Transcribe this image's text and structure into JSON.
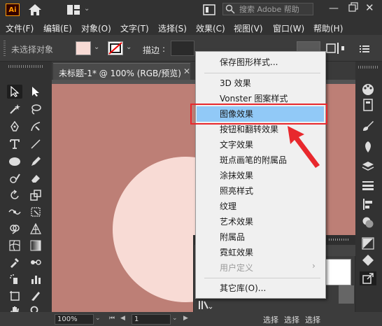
{
  "app": {
    "logo_text": "Ai",
    "search_placeholder": "搜索 Adobe 帮助",
    "accent_color": "#ff9a00"
  },
  "menubar": {
    "items": [
      "文件(F)",
      "编辑(E)",
      "对象(O)",
      "文字(T)",
      "选择(S)",
      "效果(C)",
      "视图(V)",
      "窗口(W)",
      "帮助(H)"
    ]
  },
  "controlbar": {
    "selection_status": "未选择对象",
    "fill_color": "#f8dbd5",
    "stroke_label": "描边",
    "stroke_colon": ":"
  },
  "document": {
    "tab_title": "未标题-1* @ 100% (RGB/预览)",
    "tab_close": "✕",
    "artboard_color": "#bd7f76",
    "circle_color": "#f8dbd5"
  },
  "dropdown": {
    "items": [
      {
        "label": "保存图形样式...",
        "enabled": true
      },
      {
        "label": "3D 效果",
        "enabled": true
      },
      {
        "label": "Vonster 图案样式",
        "enabled": true
      },
      {
        "label": "图像效果",
        "enabled": true,
        "highlighted": true
      },
      {
        "label": "按钮和翻转效果",
        "enabled": true
      },
      {
        "label": "文字效果",
        "enabled": true
      },
      {
        "label": "斑点画笔的附属品",
        "enabled": true
      },
      {
        "label": "涂抹效果",
        "enabled": true
      },
      {
        "label": "照亮样式",
        "enabled": true
      },
      {
        "label": "纹理",
        "enabled": true
      },
      {
        "label": "艺术效果",
        "enabled": true
      },
      {
        "label": "附属品",
        "enabled": true
      },
      {
        "label": "霓虹效果",
        "enabled": true
      },
      {
        "label": "用户定义",
        "enabled": false,
        "has_submenu": true
      },
      {
        "label": "其它库(O)...",
        "enabled": true
      }
    ],
    "highlight_color": "#91c9f7",
    "callout_color": "#e8282d"
  },
  "statusbar": {
    "zoom": "100%",
    "artboard_number": "1",
    "selections": [
      "选择",
      "选择",
      "选择"
    ]
  },
  "icons": {
    "window_min": "—",
    "window_close": "✕",
    "chevron": "⌄",
    "nav_first": "⏮",
    "nav_prev": "◀",
    "nav_next": "▶",
    "submenu_arrow": "›"
  }
}
